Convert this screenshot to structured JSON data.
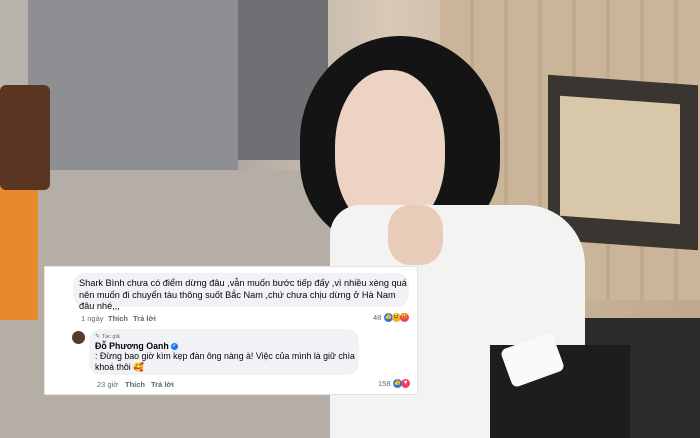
{
  "comment": {
    "text": "Shark Bình chưa có điểm dừng đâu ,vẫn muốn bước tiếp đấy ,vì nhiều xèng quá nên muốn đi chuyển tàu thông suốt Bắc Nam ,chứ chưa chịu dừng ở Hà Nam đâu nhé,,,",
    "time": "1 ngày",
    "like_label": "Thích",
    "reply_label": "Trả lời",
    "reaction_count": "48",
    "reactions": [
      "like-icon",
      "haha-icon",
      "angry-icon"
    ]
  },
  "reply": {
    "author_tag": "Tác giả",
    "author_name": "Đỗ Phương Oanh",
    "text": ": Đừng bao giờ kìm kẹp đàn ông nàng à! Việc của mình là giữ chìa khoá thôi 🥰",
    "time": "23 giờ",
    "like_label": "Thích",
    "reply_label": "Trả lời",
    "reaction_count": "158",
    "reactions": [
      "like-icon",
      "heart-icon"
    ]
  },
  "colors": {
    "like": "#1877f2",
    "heart": "#f33e58",
    "bubble": "#f0f2f5"
  }
}
